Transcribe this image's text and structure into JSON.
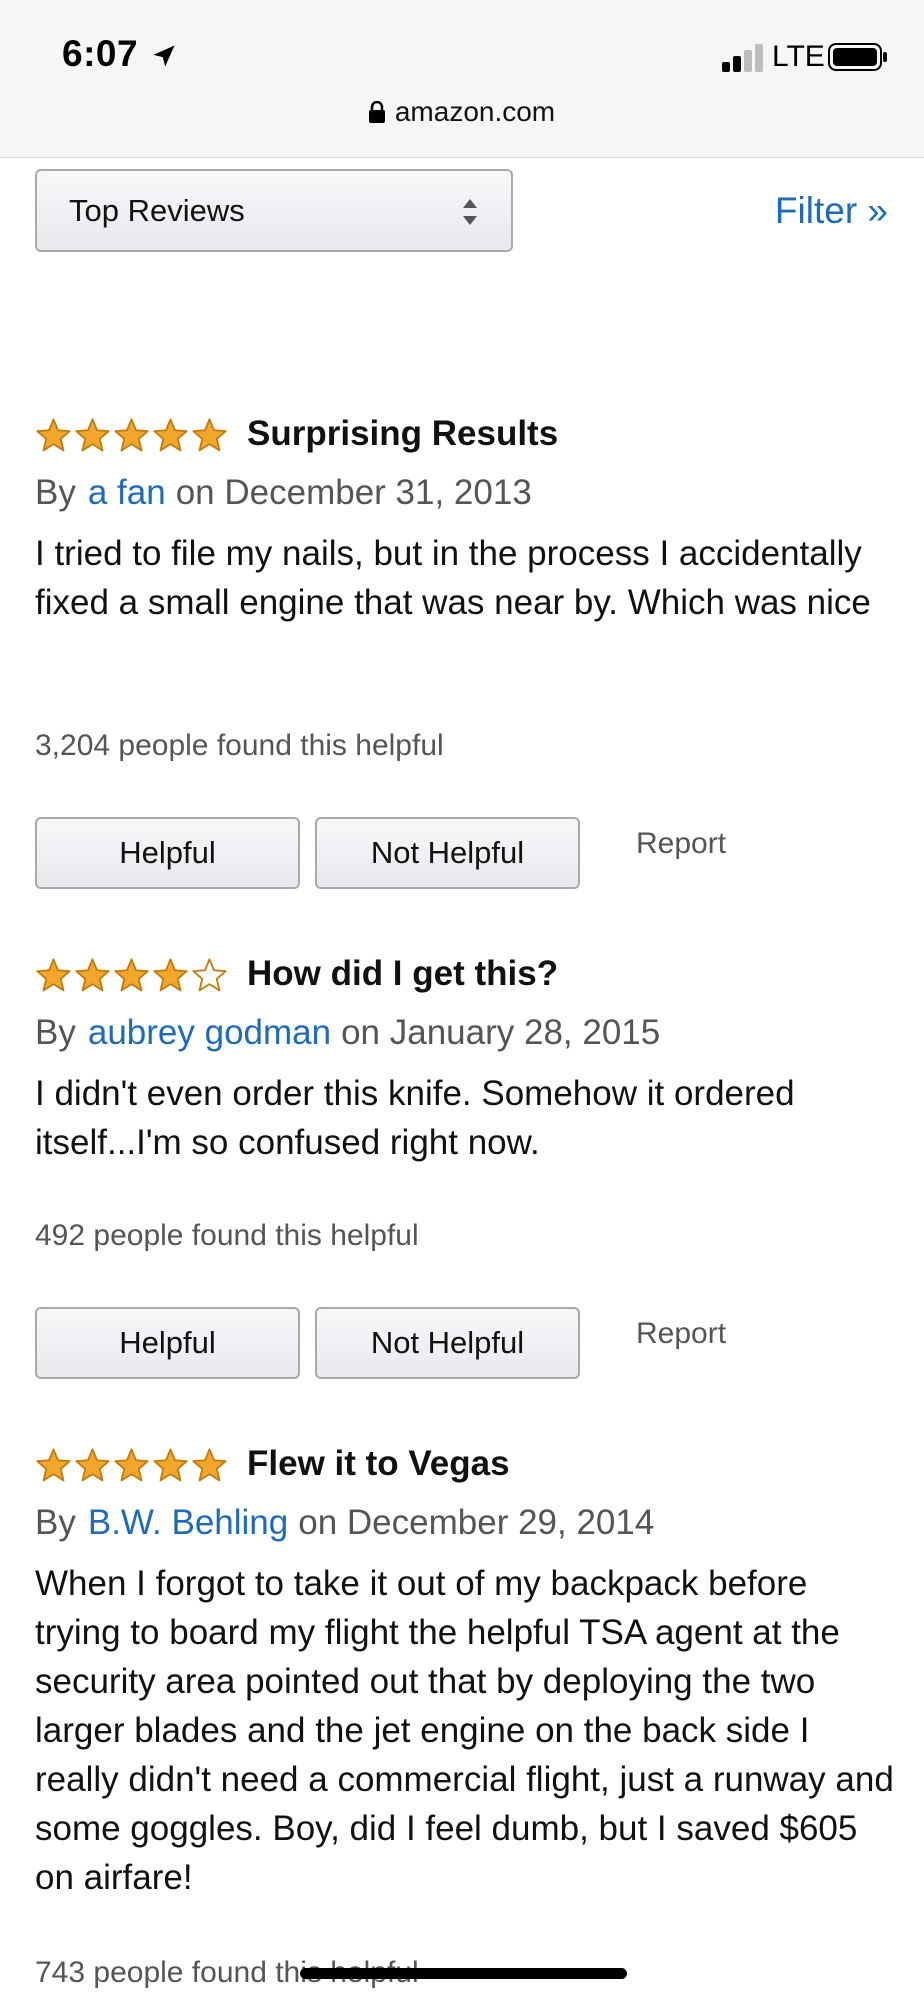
{
  "status_bar": {
    "time": "6:07",
    "network": "LTE"
  },
  "browser": {
    "url": "amazon.com"
  },
  "toolbar": {
    "sort_label": "Top Reviews",
    "filter_label": "Filter »"
  },
  "colors": {
    "link": "#1f6bba",
    "star": "#f3a62c",
    "star_stroke": "#c07d0e"
  },
  "reviews": [
    {
      "rating": 5,
      "title": "Surprising Results",
      "by_label": "By",
      "author": "a fan",
      "date": "on December 31, 2013",
      "body": "I tried to file my nails, but in the process I accidentally fixed a small engine that was near by. Which was nice",
      "helpful_text": "3,204 people found this helpful",
      "helpful_button": "Helpful",
      "not_helpful_button": "Not Helpful",
      "report_label": "Report"
    },
    {
      "rating": 4,
      "title": "How did I get this?",
      "by_label": "By",
      "author": "aubrey godman",
      "date": "on January 28, 2015",
      "body": "I didn't even order this knife. Somehow it ordered itself...I'm so confused right now.",
      "helpful_text": "492 people found this helpful",
      "helpful_button": "Helpful",
      "not_helpful_button": "Not Helpful",
      "report_label": "Report"
    },
    {
      "rating": 5,
      "title": "Flew it to Vegas",
      "by_label": "By",
      "author": "B.W. Behling",
      "date": "on December 29, 2014",
      "body": "When I forgot to take it out of my backpack before trying to board my flight the helpful TSA agent at the security area pointed out that by deploying the two larger blades and the jet engine on the back side I really didn't need a commercial flight, just a runway and some goggles. Boy, did I feel dumb, but I saved $605 on airfare!",
      "helpful_text": "743 people found this helpful"
    }
  ]
}
